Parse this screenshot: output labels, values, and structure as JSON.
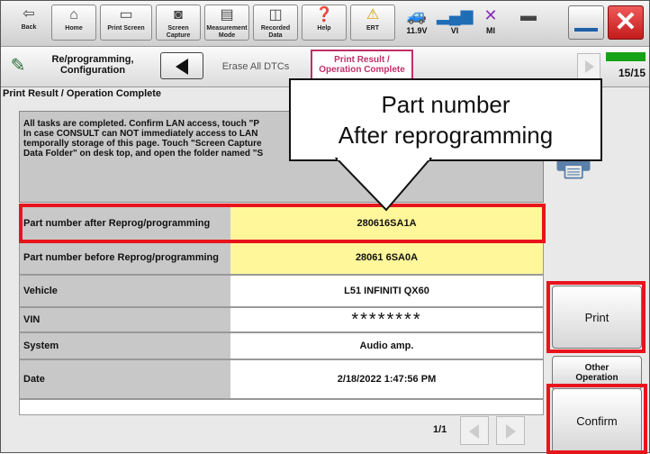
{
  "toolbar": {
    "back": "Back",
    "home": "Home",
    "print_screen": "Print Screen",
    "screen_capture": "Screen Capture",
    "measurement_mode": "Measurement Mode",
    "recorded_data": "Recorded Data",
    "help": "Help",
    "ert": "ERT",
    "voltage": "11.9V",
    "vi": "VI",
    "mi": "MI"
  },
  "breadcrumb": {
    "title": "Re/programming, Configuration",
    "step": "Erase All DTCs",
    "active": "Print Result / Operation Complete",
    "progress_label": "15/15",
    "progress_fraction": 1.0
  },
  "page_title": "Print Result / Operation Complete",
  "message_lines": [
    "All tasks are completed. Confirm LAN access, touch \"P",
    "In case CONSULT can NOT immediately access to LAN",
    "temporally storage of this page. Touch \"Screen Capture",
    "Data Folder\" on desk top, and open the folder named \"S"
  ],
  "table": [
    {
      "key": "Part number after Reprog/programming",
      "value": "280616SA1A"
    },
    {
      "key": "Part number before Reprog/programming",
      "value": "28061 6SA0A"
    },
    {
      "key": "Vehicle",
      "value": "L51 INFINITI QX60"
    },
    {
      "key": "VIN",
      "value": "********"
    },
    {
      "key": "System",
      "value": "Audio amp."
    },
    {
      "key": "Date",
      "value": "2/18/2022 1:47:56 PM"
    }
  ],
  "pager": "1/1",
  "buttons": {
    "print": "Print",
    "other_operation": "Other Operation",
    "confirm": "Confirm"
  },
  "callout": {
    "line1": "Part number",
    "line2": "After reprogramming"
  },
  "colors": {
    "highlight_red": "#e8141c",
    "value_yellow": "#fff79a",
    "active_tab": "#c0306a",
    "progress_green": "#16a216"
  }
}
